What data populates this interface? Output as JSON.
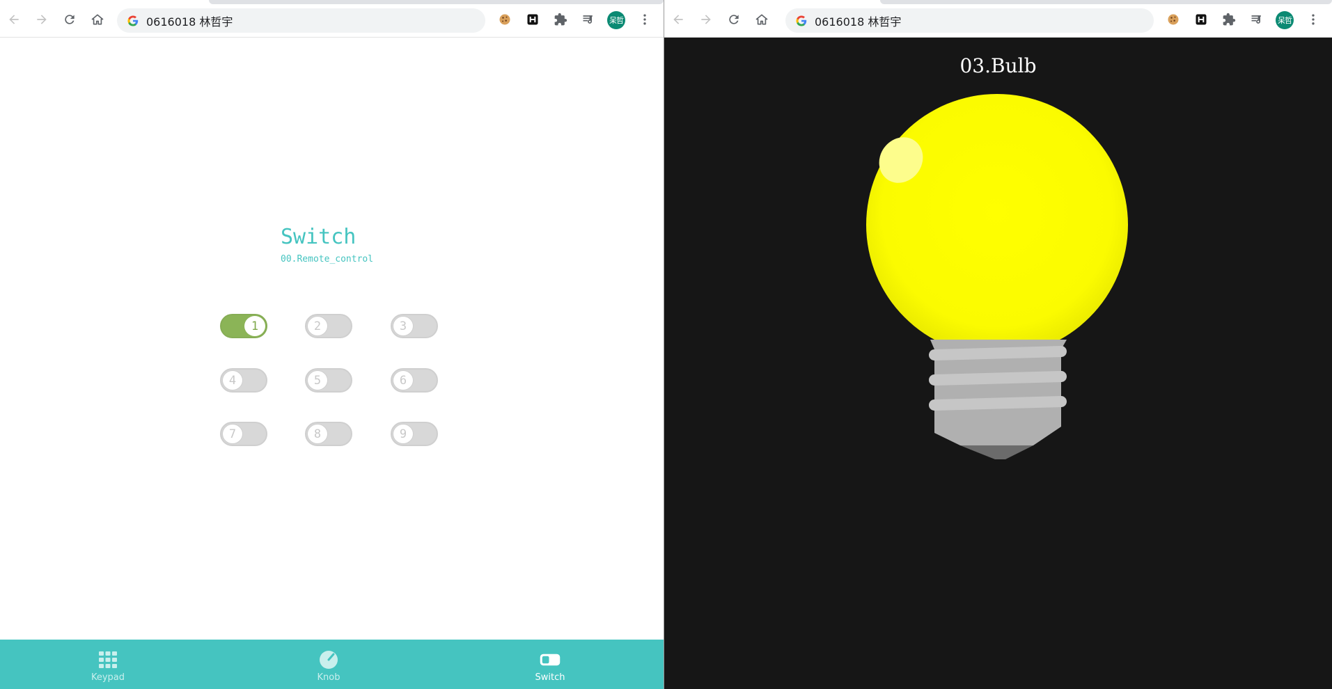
{
  "browser": {
    "left": {
      "url": "0616018 林哲宇",
      "profile_initials": "呆哲"
    },
    "right": {
      "url": "0616018 林哲宇",
      "profile_initials": "呆哲"
    }
  },
  "switch_app": {
    "title": "Switch",
    "subtitle": "00.Remote_control",
    "toggles": [
      {
        "label": "1",
        "on": true
      },
      {
        "label": "2",
        "on": false
      },
      {
        "label": "3",
        "on": false
      },
      {
        "label": "4",
        "on": false
      },
      {
        "label": "5",
        "on": false
      },
      {
        "label": "6",
        "on": false
      },
      {
        "label": "7",
        "on": false
      },
      {
        "label": "8",
        "on": false
      },
      {
        "label": "9",
        "on": false
      }
    ],
    "nav": [
      {
        "label": "Keypad",
        "icon": "keypad-icon",
        "active": false
      },
      {
        "label": "Knob",
        "icon": "knob-icon",
        "active": false
      },
      {
        "label": "Switch",
        "icon": "switch-icon",
        "active": true
      }
    ],
    "accent_color": "#45c4c0",
    "toggle_on_color": "#8bb457"
  },
  "bulb_app": {
    "title": "03.Bulb",
    "state": "on",
    "bulb_color": "#fdfd00",
    "background": "#161616"
  }
}
